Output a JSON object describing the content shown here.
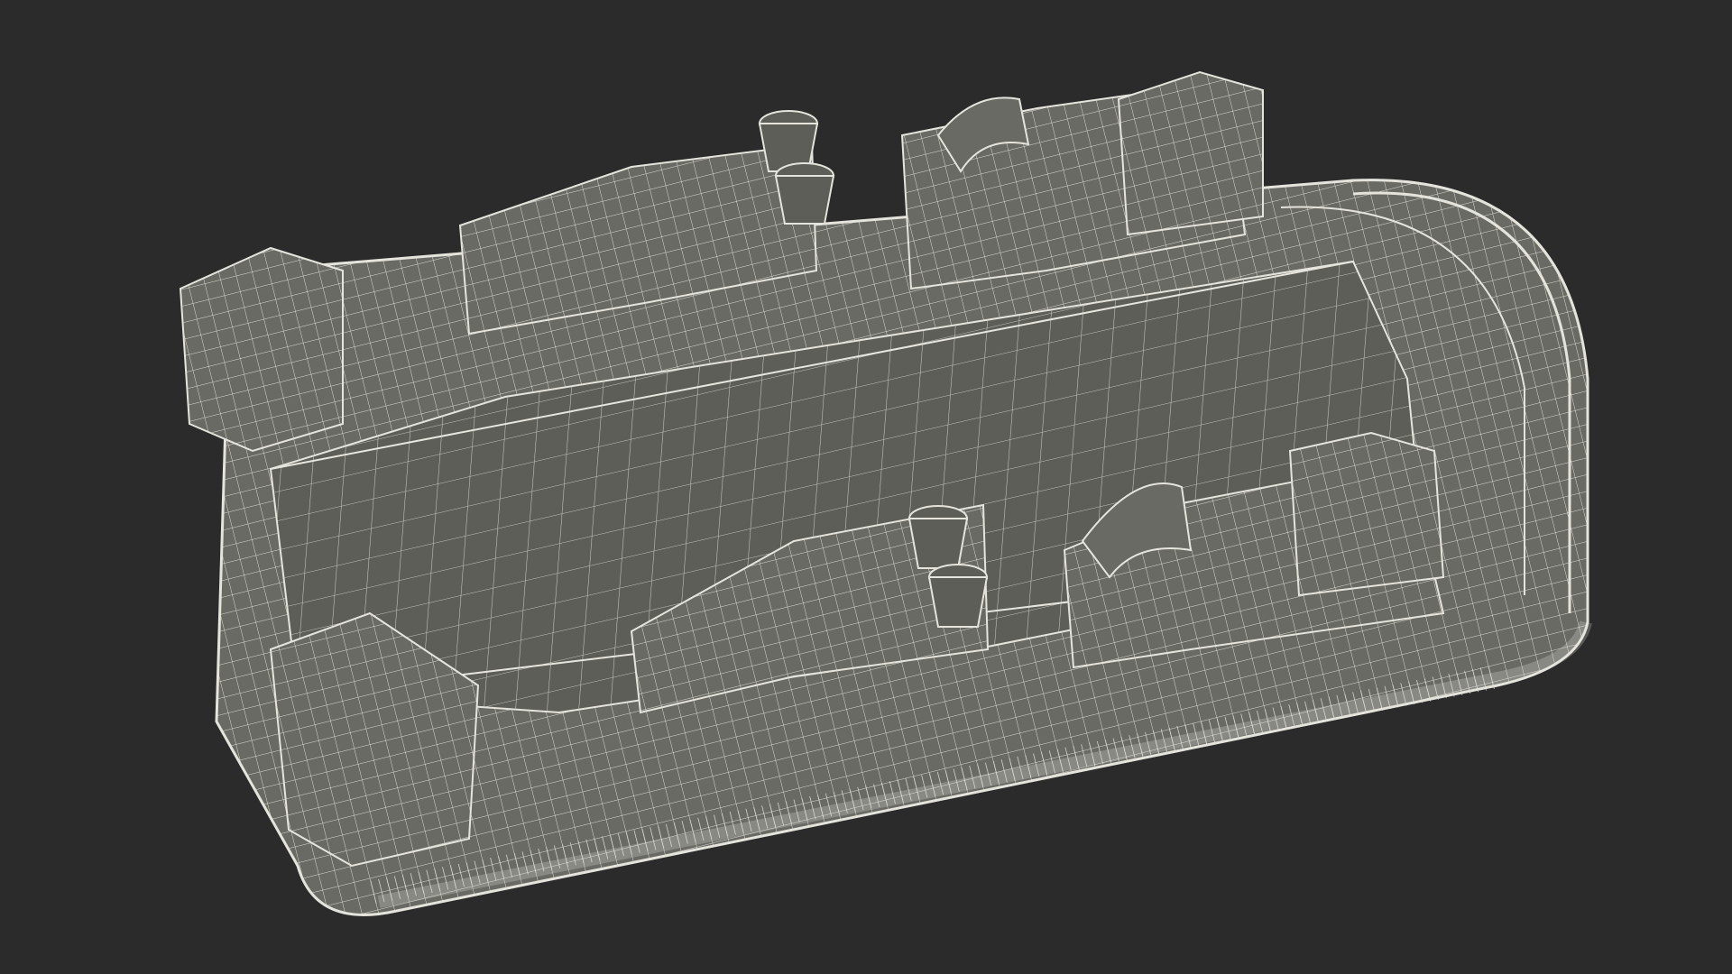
{
  "scene": {
    "subject": "wireframe-hovercraft-model",
    "background_color": "#2b2b2b",
    "hull_color": "#6a6a64",
    "deck_color": "#5e5e59",
    "wire_color": "#e4e4dc"
  }
}
